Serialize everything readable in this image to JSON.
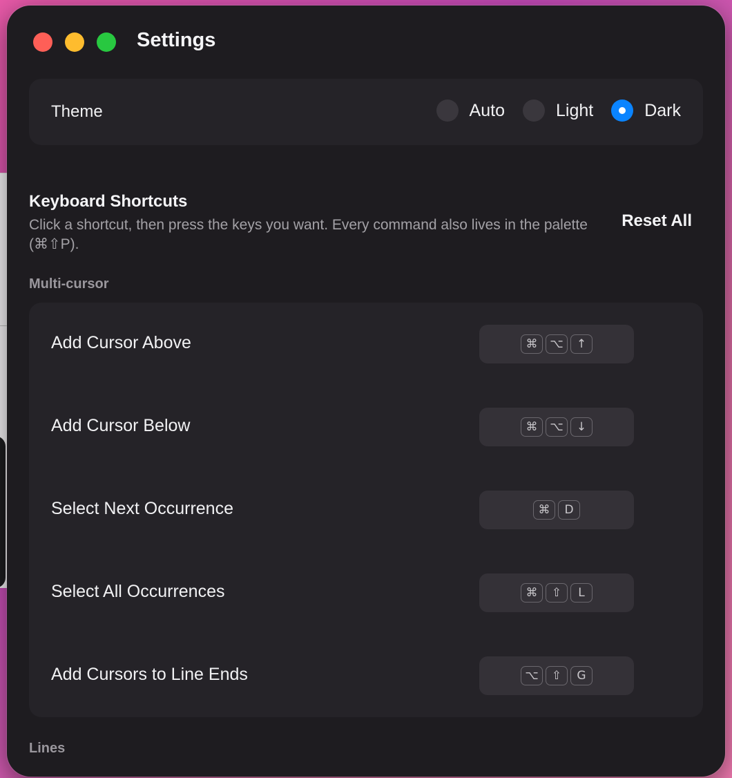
{
  "window": {
    "title": "Settings"
  },
  "theme": {
    "label": "Theme",
    "options": [
      {
        "label": "Auto",
        "selected": false
      },
      {
        "label": "Light",
        "selected": false
      },
      {
        "label": "Dark",
        "selected": true
      }
    ],
    "accent_color": "#0a84ff"
  },
  "keyboard_shortcuts": {
    "title": "Keyboard Shortcuts",
    "description": "Click a shortcut, then press the keys you want. Every command also lives in the palette (⌘⇧P).",
    "reset_label": "Reset All"
  },
  "sections": {
    "multi_cursor": "Multi-cursor",
    "lines": "Lines"
  },
  "shortcuts": [
    {
      "name": "Add Cursor Above",
      "keys": [
        "⌘",
        "⌥",
        "↑"
      ]
    },
    {
      "name": "Add Cursor Below",
      "keys": [
        "⌘",
        "⌥",
        "↓"
      ]
    },
    {
      "name": "Select Next Occurrence",
      "keys": [
        "⌘",
        "D"
      ]
    },
    {
      "name": "Select All Occurrences",
      "keys": [
        "⌘",
        "⇧",
        "L"
      ]
    },
    {
      "name": "Add Cursors to Line Ends",
      "keys": [
        "⌥",
        "⇧",
        "G"
      ]
    }
  ]
}
